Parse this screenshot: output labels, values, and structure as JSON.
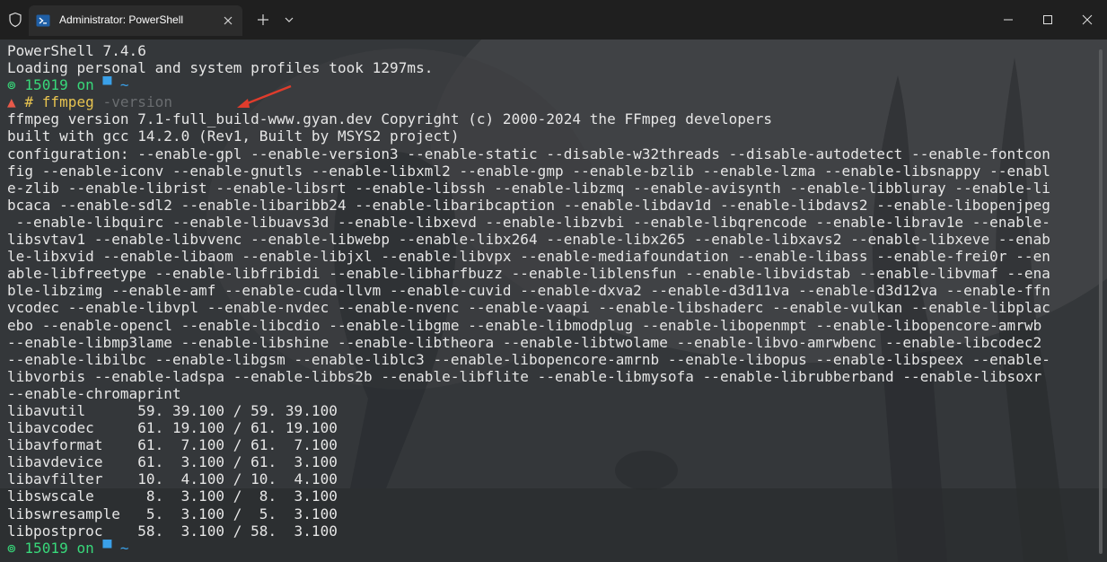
{
  "titlebar": {
    "tab_title": "Administrator: PowerShell"
  },
  "terminal": {
    "header1": "PowerShell 7.4.6",
    "header2": "Loading personal and system profiles took 1297ms.",
    "prompt1": {
      "symbol": "⊚",
      "user": "15019",
      "on": "on",
      "folder_icon": "▀",
      "path": "~"
    },
    "cmd": {
      "caret": "▲",
      "hash": "#",
      "command": "ffmpeg",
      "arg": "-version"
    },
    "output": [
      "ffmpeg version 7.1-full_build-www.gyan.dev Copyright (c) 2000-2024 the FFmpeg developers",
      "built with gcc 14.2.0 (Rev1, Built by MSYS2 project)",
      "configuration: --enable-gpl --enable-version3 --enable-static --disable-w32threads --disable-autodetect --enable-fontcon",
      "fig --enable-iconv --enable-gnutls --enable-libxml2 --enable-gmp --enable-bzlib --enable-lzma --enable-libsnappy --enabl",
      "e-zlib --enable-librist --enable-libsrt --enable-libssh --enable-libzmq --enable-avisynth --enable-libbluray --enable-li",
      "bcaca --enable-sdl2 --enable-libaribb24 --enable-libaribcaption --enable-libdav1d --enable-libdavs2 --enable-libopenjpeg",
      " --enable-libquirc --enable-libuavs3d --enable-libxevd --enable-libzvbi --enable-libqrencode --enable-librav1e --enable-",
      "libsvtav1 --enable-libvvenc --enable-libwebp --enable-libx264 --enable-libx265 --enable-libxavs2 --enable-libxeve --enab",
      "le-libxvid --enable-libaom --enable-libjxl --enable-libvpx --enable-mediafoundation --enable-libass --enable-frei0r --en",
      "able-libfreetype --enable-libfribidi --enable-libharfbuzz --enable-liblensfun --enable-libvidstab --enable-libvmaf --ena",
      "ble-libzimg --enable-amf --enable-cuda-llvm --enable-cuvid --enable-dxva2 --enable-d3d11va --enable-d3d12va --enable-ffn",
      "vcodec --enable-libvpl --enable-nvdec --enable-nvenc --enable-vaapi --enable-libshaderc --enable-vulkan --enable-libplac",
      "ebo --enable-opencl --enable-libcdio --enable-libgme --enable-libmodplug --enable-libopenmpt --enable-libopencore-amrwb",
      "--enable-libmp3lame --enable-libshine --enable-libtheora --enable-libtwolame --enable-libvo-amrwbenc --enable-libcodec2",
      "--enable-libilbc --enable-libgsm --enable-liblc3 --enable-libopencore-amrnb --enable-libopus --enable-libspeex --enable-",
      "libvorbis --enable-ladspa --enable-libbs2b --enable-libflite --enable-libmysofa --enable-librubberband --enable-libsoxr",
      "--enable-chromaprint",
      "libavutil      59. 39.100 / 59. 39.100",
      "libavcodec     61. 19.100 / 61. 19.100",
      "libavformat    61.  7.100 / 61.  7.100",
      "libavdevice    61.  3.100 / 61.  3.100",
      "libavfilter    10.  4.100 / 10.  4.100",
      "libswscale      8.  3.100 /  8.  3.100",
      "libswresample   5.  3.100 /  5.  3.100",
      "libpostproc    58.  3.100 / 58.  3.100"
    ],
    "prompt2": {
      "symbol": "⊚",
      "user": "15019",
      "on": "on",
      "folder_icon": "▀",
      "path": "~"
    }
  },
  "colors": {
    "prompt_green": "#38d87a",
    "path_blue": "#3aa0e8",
    "command_yellow": "#e8c450",
    "arg_gray": "#6a6d70",
    "annotation_red": "#e03c2c"
  },
  "icons": {
    "window": "shield-icon",
    "tab": "powershell-icon",
    "tab_close": "close-icon",
    "new_tab": "plus-icon",
    "dropdown": "chevron-down-icon",
    "minimize": "minimize-icon",
    "maximize": "maximize-icon",
    "close": "close-icon"
  }
}
